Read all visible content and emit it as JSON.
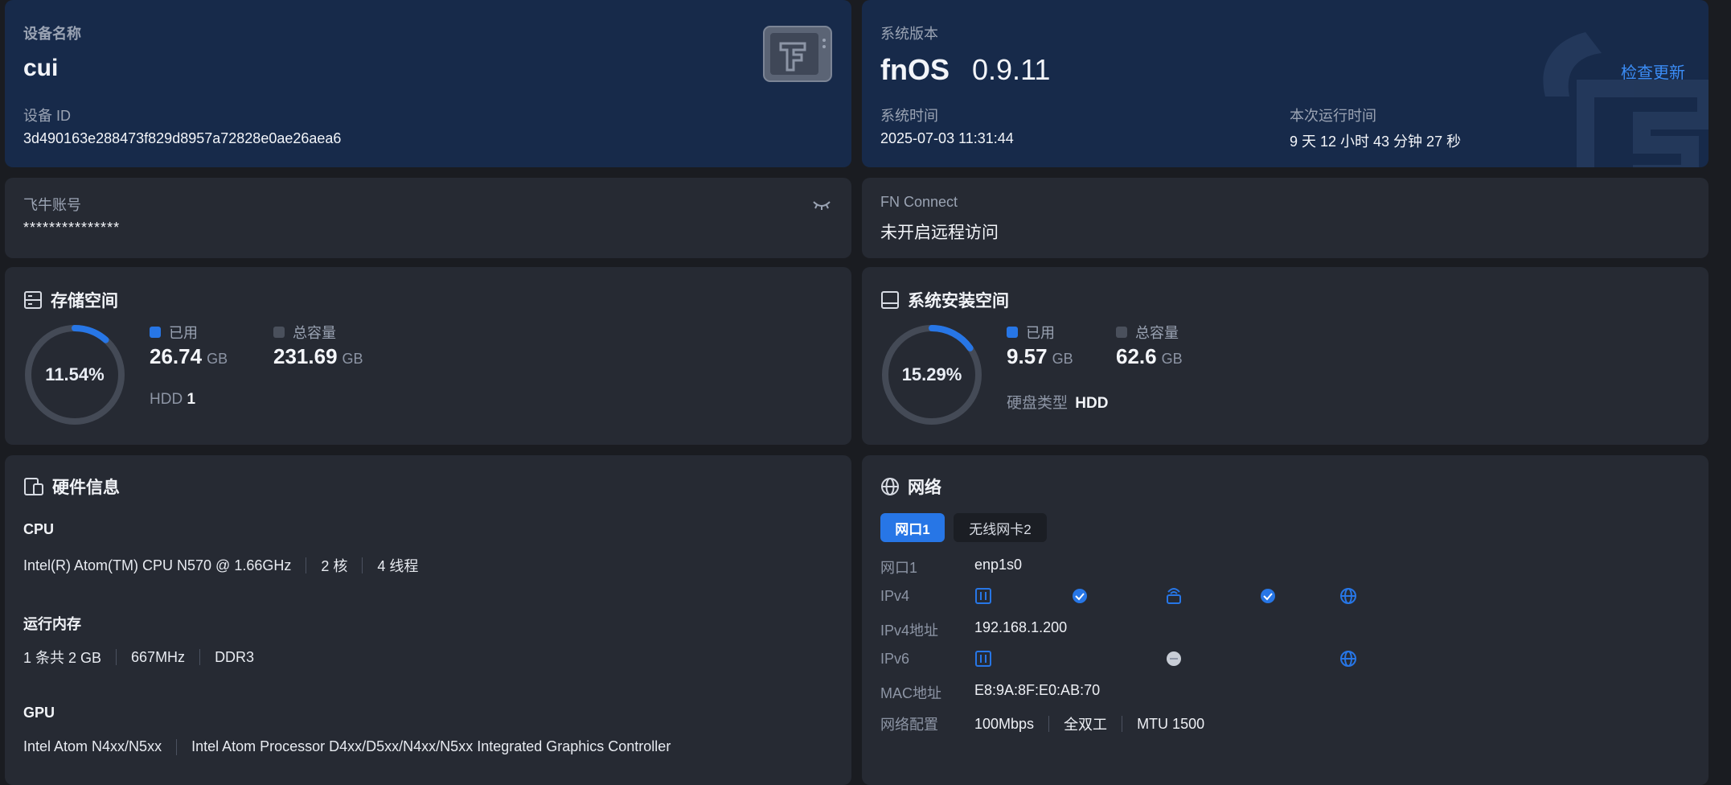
{
  "device": {
    "name_label": "设备名称",
    "name": "cui",
    "id_label": "设备 ID",
    "id": "3d490163e288473f829d8957a72828e0ae26aea6",
    "image_icon": "nas-box-icon"
  },
  "system": {
    "version_label": "系统版本",
    "os_name": "fnOS",
    "version": "0.9.11",
    "check_update": "检查更新",
    "time_label": "系统时间",
    "time": "2025-07-03 11:31:44",
    "uptime_label": "本次运行时间",
    "uptime": "9 天 12 小时 43 分钟 27 秒"
  },
  "account": {
    "label": "飞牛账号",
    "value": "***************",
    "toggle_icon": "eye-closed-icon"
  },
  "connect": {
    "label": "FN Connect",
    "value": "未开启远程访问"
  },
  "storage": {
    "title": "存储空间",
    "icon": "storage-icon",
    "percent_text": "11.54%",
    "percent": 11.54,
    "used_label": "已用",
    "used_value": "26.74",
    "used_unit": "GB",
    "total_label": "总容量",
    "total_value": "231.69",
    "total_unit": "GB",
    "disk_type_label": "HDD",
    "disk_count": "1"
  },
  "sysdisk": {
    "title": "系统安装空间",
    "icon": "drive-icon",
    "percent_text": "15.29%",
    "percent": 15.29,
    "used_label": "已用",
    "used_value": "9.57",
    "used_unit": "GB",
    "total_label": "总容量",
    "total_value": "62.6",
    "total_unit": "GB",
    "disk_type_label": "硬盘类型",
    "disk_type": "HDD"
  },
  "hardware": {
    "title": "硬件信息",
    "icon": "devices-icon",
    "cpu_label": "CPU",
    "cpu_model": "Intel(R) Atom(TM) CPU N570 @ 1.66GHz",
    "cpu_cores": "2 核",
    "cpu_threads": "4 线程",
    "ram_label": "运行内存",
    "ram_size": "1 条共 2 GB",
    "ram_freq": "667MHz",
    "ram_type": "DDR3",
    "gpu_label": "GPU",
    "gpu_name": "Intel Atom N4xx/N5xx",
    "gpu_desc": "Intel Atom Processor D4xx/D5xx/N4xx/N5xx Integrated Graphics Controller"
  },
  "network": {
    "title": "网络",
    "icon": "globe-icon",
    "tabs": [
      "网口1",
      "无线网卡2"
    ],
    "port_label": "网口1",
    "port_value": "enp1s0",
    "ipv4_label": "IPv4",
    "ipv4_addr_label": "IPv4地址",
    "ipv4_addr": "192.168.1.200",
    "ipv6_label": "IPv6",
    "mac_label": "MAC地址",
    "mac": "E8:9A:8F:E0:AB:70",
    "config_label": "网络配置",
    "speed": "100Mbps",
    "duplex": "全双工",
    "mtu": "MTU 1500"
  },
  "colors": {
    "accent": "#2776e6",
    "card": "#262a33",
    "card_blue": "#172a4a",
    "ring_track": "#444a56"
  }
}
